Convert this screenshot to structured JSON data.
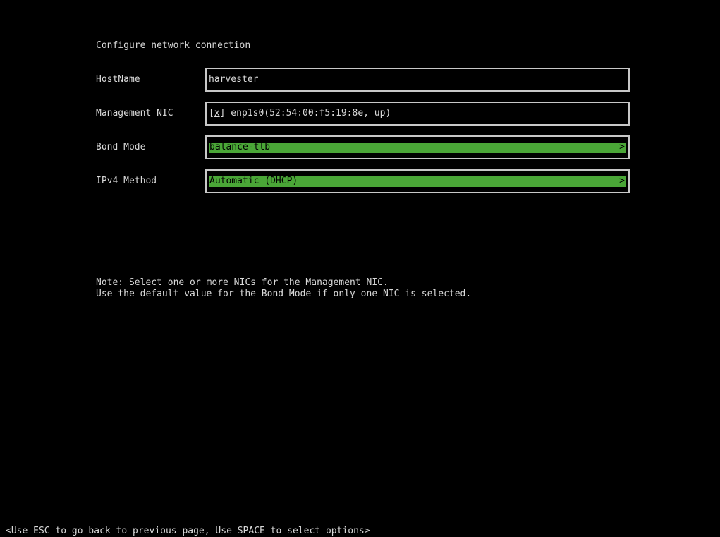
{
  "title": "Configure network connection",
  "fields": {
    "hostname": {
      "label": "HostName",
      "value": "harvester"
    },
    "management_nic": {
      "label": "Management NIC",
      "checkbox_open": "[",
      "checkbox_mark": "x",
      "checkbox_close": "]",
      "nic_text": " enp1s0(52:54:00:f5:19:8e, up)"
    },
    "bond_mode": {
      "label": "Bond Mode",
      "value": "balance-tlb",
      "arrow": ">"
    },
    "ipv4_method": {
      "label": "IPv4 Method",
      "value": "Automatic (DHCP)",
      "arrow": ">"
    }
  },
  "note": {
    "line1": "Note: Select one or more NICs for the Management NIC.",
    "line2": "Use the default value for the Bond Mode if only one NIC is selected."
  },
  "footer": "<Use ESC to go back to previous page, Use SPACE to select options>",
  "colors": {
    "background": "#000000",
    "text": "#d8d8d8",
    "selection": "#4aa637",
    "border": "#c8c8c8"
  }
}
